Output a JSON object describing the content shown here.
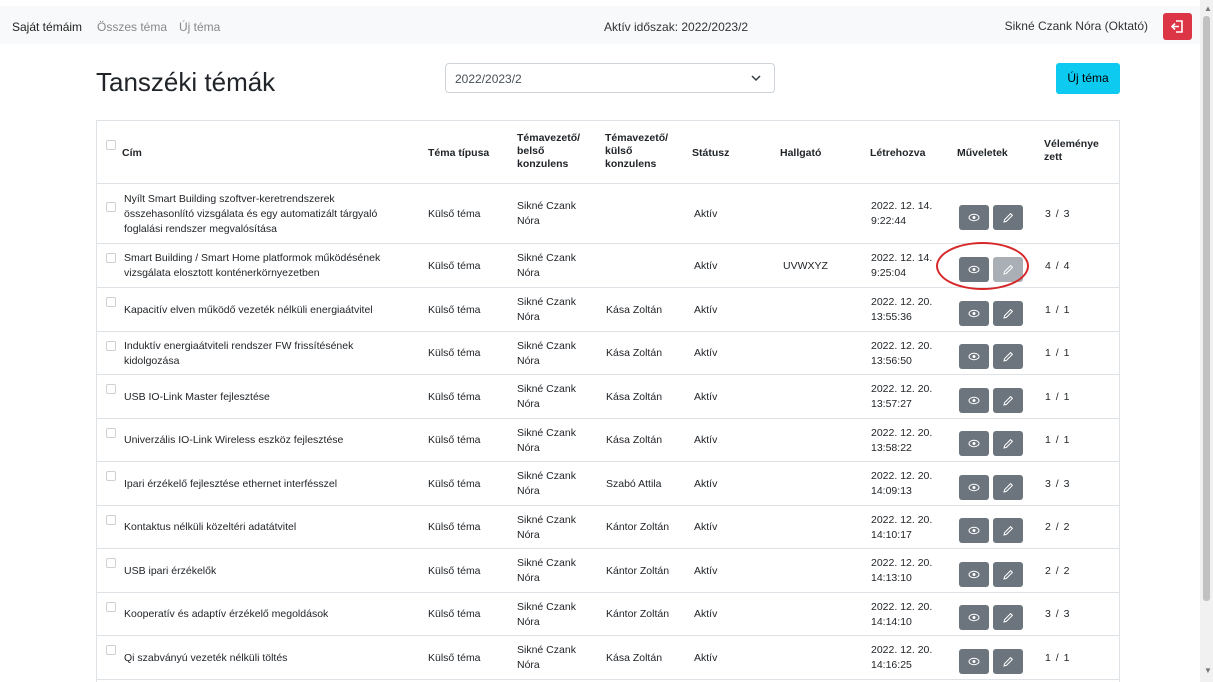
{
  "nav": {
    "my_topics": "Saját témáim",
    "all_topics": "Összes téma",
    "new_topic": "Új téma",
    "active_period": "Aktív időszak: 2022/2023/2",
    "user": "Sikné Czank Nóra (Oktató)",
    "logout_icon": "logout-icon"
  },
  "main": {
    "title": "Tanszéki témák",
    "period_value": "2022/2023/2",
    "new_button": "Új téma"
  },
  "table": {
    "headers": {
      "title": "Cím",
      "type": "Téma típusa",
      "internal_l1": "Témavezető/",
      "internal_l2": "belső",
      "internal_l3": "konzulens",
      "external_l1": "Témavezető/",
      "external_l2": "külső",
      "external_l3": "konzulens",
      "status": "Státusz",
      "student": "Hallgató",
      "created": "Létrehozva",
      "actions": "Műveletek",
      "review_l1": "Véleménye",
      "review_l2": "zett"
    },
    "rows": [
      {
        "title_l1": "Nyílt Smart Building szoftver-keretrendszerek",
        "title_l2": "összehasonlító vizsgálata és egy automatizált tárgyaló",
        "title_l3": "foglalási rendszer megvalósítása",
        "type": "Külső téma",
        "int_l1": "Sikné Czank",
        "int_l2": "Nóra",
        "ext": "",
        "status": "Aktív",
        "student": "",
        "date": "2022. 12. 14.",
        "time": "9:22:44",
        "review": "3 / 3",
        "edit_disabled": false
      },
      {
        "title_l1": "Smart Building / Smart Home platformok működésének",
        "title_l2": "vizsgálata elosztott konténerkörnyezetben",
        "title_l3": "",
        "type": "Külső téma",
        "int_l1": "Sikné Czank",
        "int_l2": "Nóra",
        "ext": "",
        "status": "Aktív",
        "student": "UVWXYZ",
        "date": "2022. 12. 14.",
        "time": "9:25:04",
        "review": "4 / 4",
        "edit_disabled": true
      },
      {
        "title_l1": "Kapacitív elven működő vezeték nélküli energiaátvitel",
        "title_l2": "",
        "title_l3": "",
        "type": "Külső téma",
        "int_l1": "Sikné Czank",
        "int_l2": "Nóra",
        "ext": "Kása Zoltán",
        "status": "Aktív",
        "student": "",
        "date": "2022. 12. 20.",
        "time": "13:55:36",
        "review": "1 / 1",
        "edit_disabled": false
      },
      {
        "title_l1": "Induktív energiaátviteli rendszer FW frissítésének",
        "title_l2": "kidolgozása",
        "title_l3": "",
        "type": "Külső téma",
        "int_l1": "Sikné Czank",
        "int_l2": "Nóra",
        "ext": "Kása Zoltán",
        "status": "Aktív",
        "student": "",
        "date": "2022. 12. 20.",
        "time": "13:56:50",
        "review": "1 / 1",
        "edit_disabled": false
      },
      {
        "title_l1": "USB IO-Link Master fejlesztése",
        "title_l2": "",
        "title_l3": "",
        "type": "Külső téma",
        "int_l1": "Sikné Czank",
        "int_l2": "Nóra",
        "ext": "Kása Zoltán",
        "status": "Aktív",
        "student": "",
        "date": "2022. 12. 20.",
        "time": "13:57:27",
        "review": "1 / 1",
        "edit_disabled": false
      },
      {
        "title_l1": "Univerzális IO-Link Wireless eszköz fejlesztése",
        "title_l2": "",
        "title_l3": "",
        "type": "Külső téma",
        "int_l1": "Sikné Czank",
        "int_l2": "Nóra",
        "ext": "Kása Zoltán",
        "status": "Aktív",
        "student": "",
        "date": "2022. 12. 20.",
        "time": "13:58:22",
        "review": "1 / 1",
        "edit_disabled": false
      },
      {
        "title_l1": "Ipari érzékelő fejlesztése ethernet interfésszel",
        "title_l2": "",
        "title_l3": "",
        "type": "Külső téma",
        "int_l1": "Sikné Czank",
        "int_l2": "Nóra",
        "ext": "Szabó Attila",
        "status": "Aktív",
        "student": "",
        "date": "2022. 12. 20.",
        "time": "14:09:13",
        "review": "3 / 3",
        "edit_disabled": false
      },
      {
        "title_l1": "Kontaktus nélküli közeltéri adatátvitel",
        "title_l2": "",
        "title_l3": "",
        "type": "Külső téma",
        "int_l1": "Sikné Czank",
        "int_l2": "Nóra",
        "ext": "Kántor Zoltán",
        "status": "Aktív",
        "student": "",
        "date": "2022. 12. 20.",
        "time": "14:10:17",
        "review": "2 / 2",
        "edit_disabled": false
      },
      {
        "title_l1": "USB ipari érzékelők",
        "title_l2": "",
        "title_l3": "",
        "type": "Külső téma",
        "int_l1": "Sikné Czank",
        "int_l2": "Nóra",
        "ext": "Kántor Zoltán",
        "status": "Aktív",
        "student": "",
        "date": "2022. 12. 20.",
        "time": "14:13:10",
        "review": "2 / 2",
        "edit_disabled": false
      },
      {
        "title_l1": "Kooperatív és adaptív érzékelő megoldások",
        "title_l2": "",
        "title_l3": "",
        "type": "Külső téma",
        "int_l1": "Sikné Czank",
        "int_l2": "Nóra",
        "ext": "Kántor Zoltán",
        "status": "Aktív",
        "student": "",
        "date": "2022. 12. 20.",
        "time": "14:14:10",
        "review": "3 / 3",
        "edit_disabled": false
      },
      {
        "title_l1": "Qi szabványú vezeték nélküli töltés",
        "title_l2": "",
        "title_l3": "",
        "type": "Külső téma",
        "int_l1": "Sikné Czank",
        "int_l2": "Nóra",
        "ext": "Kása Zoltán",
        "status": "Aktív",
        "student": "",
        "date": "2022. 12. 20.",
        "time": "14:16:25",
        "review": "1 / 1",
        "edit_disabled": false
      }
    ]
  }
}
